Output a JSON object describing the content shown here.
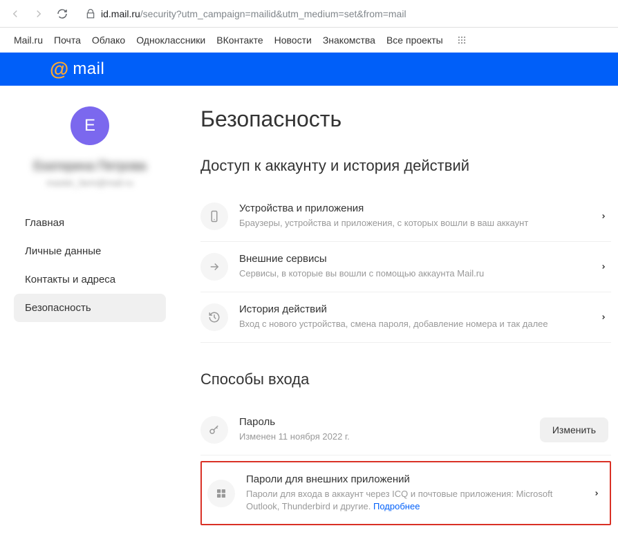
{
  "browser": {
    "url_domain": "id.mail.ru",
    "url_path": "/security?utm_campaign=mailid&utm_medium=set&from=mail"
  },
  "topnav": {
    "items": [
      "Mail.ru",
      "Почта",
      "Облако",
      "Одноклассники",
      "ВКонтакте",
      "Новости",
      "Знакомства",
      "Все проекты"
    ]
  },
  "logo": {
    "text": "mail"
  },
  "sidebar": {
    "avatar_letter": "Е",
    "user_name": "Екатерина Петрова",
    "user_email": "master_farm@mail.ru",
    "items": [
      {
        "label": "Главная"
      },
      {
        "label": "Личные данные"
      },
      {
        "label": "Контакты и адреса"
      },
      {
        "label": "Безопасность"
      }
    ]
  },
  "main": {
    "title": "Безопасность",
    "section1": {
      "title": "Доступ к аккаунту и история действий",
      "cards": [
        {
          "title": "Устройства и приложения",
          "subtitle": "Браузеры, устройства и приложения, с которых вошли в ваш аккаунт"
        },
        {
          "title": "Внешние сервисы",
          "subtitle": "Сервисы, в которые вы вошли с помощью аккаунта Mail.ru"
        },
        {
          "title": "История действий",
          "subtitle": "Вход с нового устройства, смена пароля, добавление номера и так далее"
        }
      ]
    },
    "section2": {
      "title": "Способы входа",
      "cards": [
        {
          "title": "Пароль",
          "subtitle": "Изменен 11 ноября 2022 г.",
          "action": "Изменить"
        },
        {
          "title": "Пароли для внешних приложений",
          "subtitle": "Пароли для входа в аккаунт через ICQ и почтовые приложения: Microsoft Outlook, Thunderbird и другие. ",
          "link": "Подробнее"
        }
      ]
    }
  }
}
